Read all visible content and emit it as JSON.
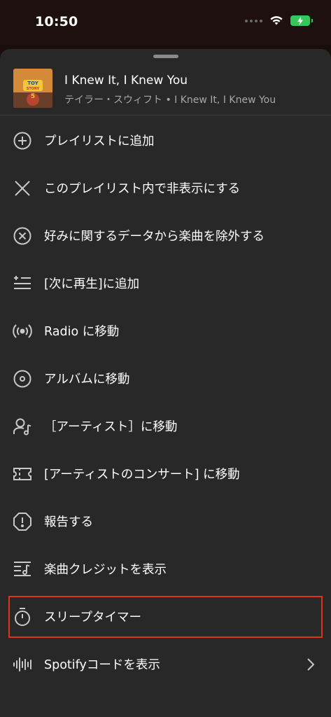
{
  "status_bar": {
    "time": "10:50"
  },
  "track": {
    "title": "I Knew It, I Knew You",
    "subtitle": "テイラー・スウィフト • I Knew It, I Knew You",
    "art_text": "TOY STORY 5"
  },
  "menu": {
    "items": [
      {
        "label": "プレイリストに追加",
        "icon": "add-circle-icon"
      },
      {
        "label": "このプレイリスト内で非表示にする",
        "icon": "close-icon"
      },
      {
        "label": "好みに関するデータから楽曲を除外する",
        "icon": "exclude-circle-icon"
      },
      {
        "label": "[次に再生]に追加",
        "icon": "add-to-queue-icon"
      },
      {
        "label": "Radio に移動",
        "icon": "radio-icon"
      },
      {
        "label": "アルバムに移動",
        "icon": "album-icon"
      },
      {
        "label": "［アーティスト］に移動",
        "icon": "artist-icon"
      },
      {
        "label": "[アーティストのコンサート] に移動",
        "icon": "ticket-icon"
      },
      {
        "label": "報告する",
        "icon": "report-icon"
      },
      {
        "label": "楽曲クレジットを表示",
        "icon": "credits-icon"
      },
      {
        "label": "スリープタイマー",
        "icon": "timer-icon"
      },
      {
        "label": "Spotifyコードを表示",
        "icon": "spotify-code-icon"
      }
    ]
  },
  "colors": {
    "sheet_background": "#282828",
    "highlight": "#e0321e",
    "battery": "#35c759"
  }
}
